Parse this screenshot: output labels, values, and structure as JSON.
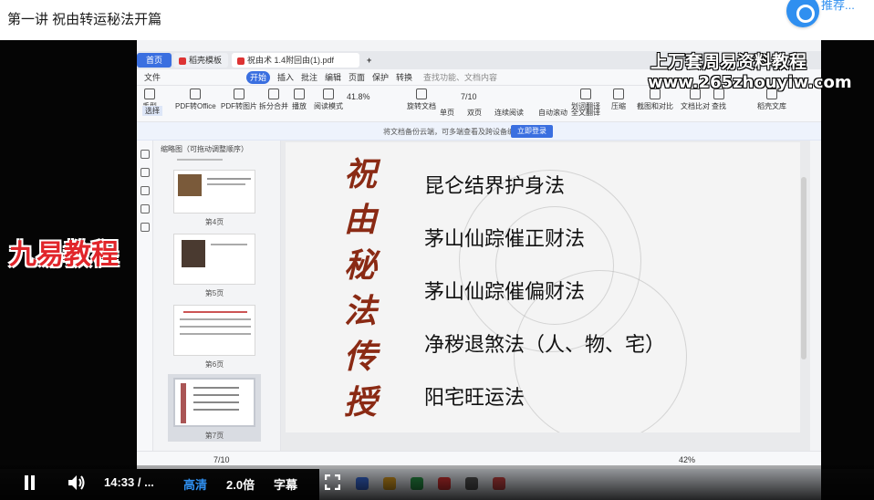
{
  "header": {
    "title": "第一讲 祝由转运秘法开篇",
    "badge_text": "推荐..."
  },
  "app": {
    "tabs": [
      {
        "label": "首页"
      },
      {
        "label": "稻壳模板"
      },
      {
        "label": "祝由术 1.4附回由(1).pdf"
      },
      {
        "label": "+"
      }
    ],
    "menu": [
      "文件",
      "开始",
      "插入",
      "批注",
      "编辑",
      "页面",
      "保护",
      "转换"
    ],
    "menu_active": "开始",
    "search_placeholder": "查找功能、文档内容",
    "toolbar": {
      "hand": "手型",
      "select": "选择",
      "pdf_to_office": "PDF转Office",
      "pdf_to_image": "PDF转图片",
      "split_merge": "拆分合并",
      "play": "播放",
      "read_mode": "阅读模式",
      "zoom": "41.8%",
      "page": "7/10",
      "single_page": "单页",
      "double_page": "双页",
      "continuous": "连续阅读",
      "auto_scroll": "自动滚动",
      "translate": "划词翻译",
      "full_translate": "全文翻译",
      "compress": "压缩",
      "screenshot_compare": "截图和对比",
      "compare": "文档比对",
      "search": "查找",
      "rotate": "旋转文档",
      "sync": "稻壳文库"
    },
    "notice": {
      "text": "将文档备份云端，可多端查看及跨设备编辑",
      "button": "立即登录"
    },
    "thumb_panel": {
      "title": "缩略图（可拖动调整顺序）",
      "items": [
        {
          "label": "第4页"
        },
        {
          "label": "第5页"
        },
        {
          "label": "第6页"
        },
        {
          "label": "第7页"
        }
      ]
    },
    "slide": {
      "vertical_title": [
        "祝",
        "由",
        "秘",
        "法",
        "传",
        "授"
      ],
      "methods": [
        "昆仑结界护身法",
        "茅山仙踪催正财法",
        "茅山仙踪催偏财法",
        "净秽退煞法（人、物、宅）",
        "阳宅旺运法"
      ]
    },
    "status": {
      "page": "7/10",
      "zoom": "42%"
    }
  },
  "watermarks": {
    "top": "上万套周易资料教程",
    "url": "www.265zhouyiw.com",
    "left": "九易教程"
  },
  "player": {
    "time": "14:33 / ...",
    "quality": "高清",
    "speed": "2.0倍",
    "subtitle": "字幕"
  },
  "colors": {
    "accent": "#3a6fe0",
    "title_red": "#8a2a14",
    "watermark_red": "#e1262b",
    "quality_blue": "#2f8ff0"
  }
}
